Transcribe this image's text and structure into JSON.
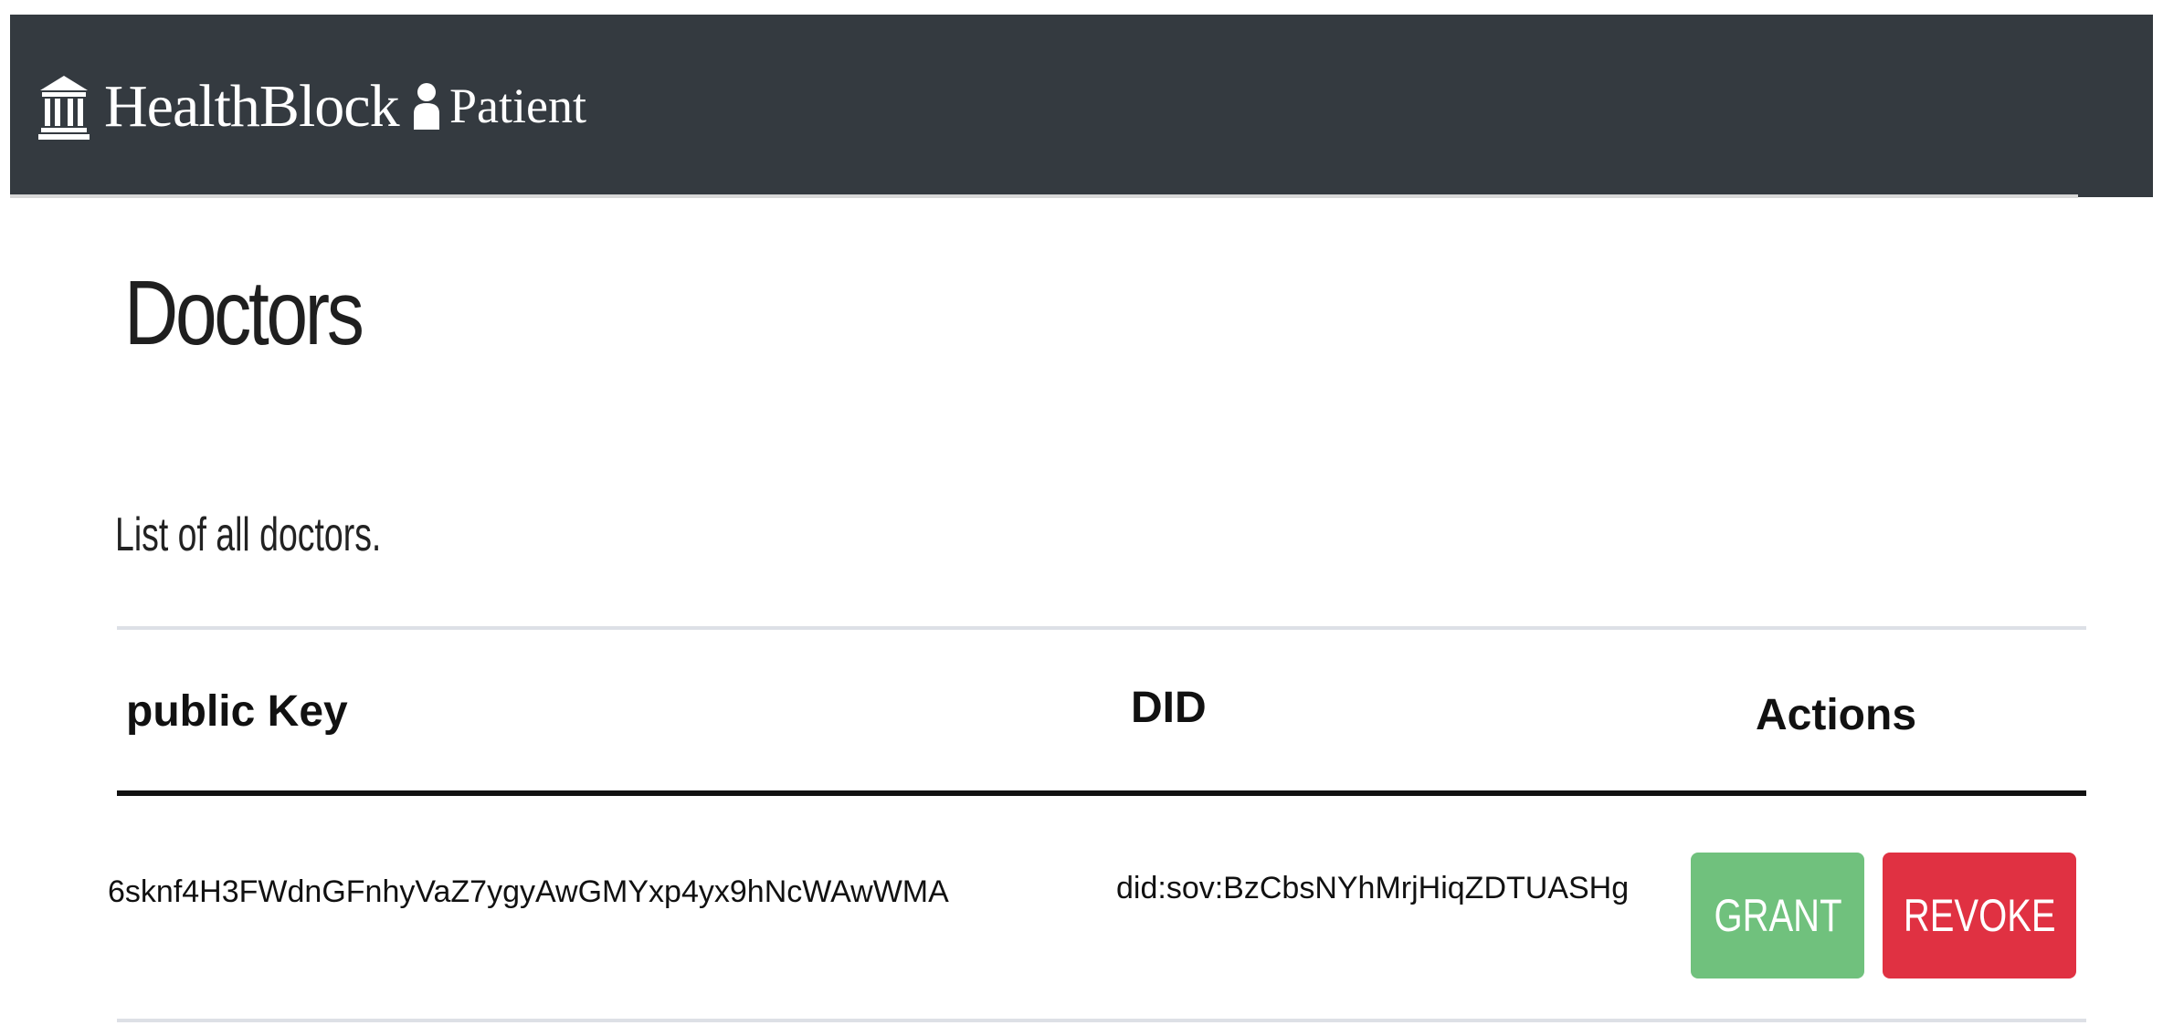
{
  "navbar": {
    "brand": "HealthBlock",
    "brand_icon": "bank-icon",
    "link_label": "Patient",
    "link_icon": "user-icon",
    "background": "#343a40"
  },
  "page": {
    "title": "Doctors",
    "lead": "List of all doctors."
  },
  "table": {
    "headers": {
      "public_key": "public Key",
      "did": "DID",
      "actions": "Actions"
    },
    "rows": [
      {
        "public_key": "6sknf4H3FWdnGFnhyVaZ7ygyAwGMYxp4yx9hNcWAwWMA",
        "did": "did:sov:BzCbsNYhMrjHiqZDTUASHg",
        "grant_label": "GRANT",
        "revoke_label": "REVOKE"
      }
    ]
  },
  "colors": {
    "grant": "#70c17d",
    "revoke": "#e03142"
  }
}
